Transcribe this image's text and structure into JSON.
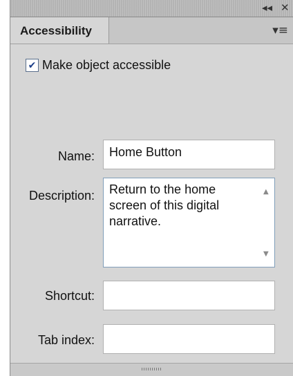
{
  "titlebar": {
    "collapse_glyph": "◂◂",
    "close_glyph": "✕"
  },
  "tab": {
    "label": "Accessibility"
  },
  "panel_menu_glyph": "▾≡",
  "checkbox": {
    "label": "Make object accessible",
    "checked": true,
    "check_glyph": "✔"
  },
  "fields": {
    "name": {
      "label": "Name:",
      "value": "Home Button"
    },
    "description": {
      "label": "Description:",
      "value": "Return to the home screen of this digital narrative."
    },
    "shortcut": {
      "label": "Shortcut:",
      "value": ""
    },
    "tab_index": {
      "label": "Tab index:",
      "value": ""
    }
  },
  "scroll_arrows": {
    "up": "▲",
    "down": "▼"
  },
  "colors": {
    "panel_bg": "#d6d6d6",
    "titlebar_bg": "#b3b3b3",
    "checkbox_check": "#1d3f8a",
    "textarea_border": "#7f9db9"
  }
}
